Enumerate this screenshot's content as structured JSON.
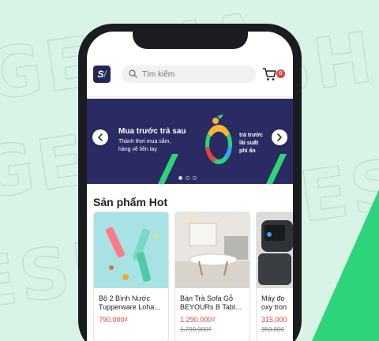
{
  "app": {
    "logo_text": "S/"
  },
  "search": {
    "placeholder": "Tìm kiếm"
  },
  "cart": {
    "count": "0"
  },
  "banner": {
    "title": "Mua trước trả sau",
    "subtitle_line1": "Thành thơi mua sắm,",
    "subtitle_line2": "hàng về liền tay",
    "right_line1": "trả trước",
    "right_line2": "lãi suất",
    "right_line3": "phí ẩn",
    "dot_count": 3,
    "active_dot": 0
  },
  "hot_section": {
    "title": "Sản phẩm Hot"
  },
  "products": [
    {
      "name_line1": "Bộ 2 Bình Nước",
      "name_line2": "Tupperware Loha...",
      "price": "790.000₫",
      "old_price": ""
    },
    {
      "name_line1": "Bàn Trà Sofa Gỗ",
      "name_line2": "BEYOURs B Tabl...",
      "price": "1.290.000₫",
      "old_price": "1.790.000₫"
    },
    {
      "name_line1": "Máy đo",
      "name_line2": "oxy tron",
      "price": "315.000",
      "old_price": "350.000"
    }
  ],
  "colors": {
    "brand_navy": "#2a2b63",
    "accent_green": "#2ed47a",
    "price_red": "#e2463a",
    "background": "#d9f3e7"
  }
}
